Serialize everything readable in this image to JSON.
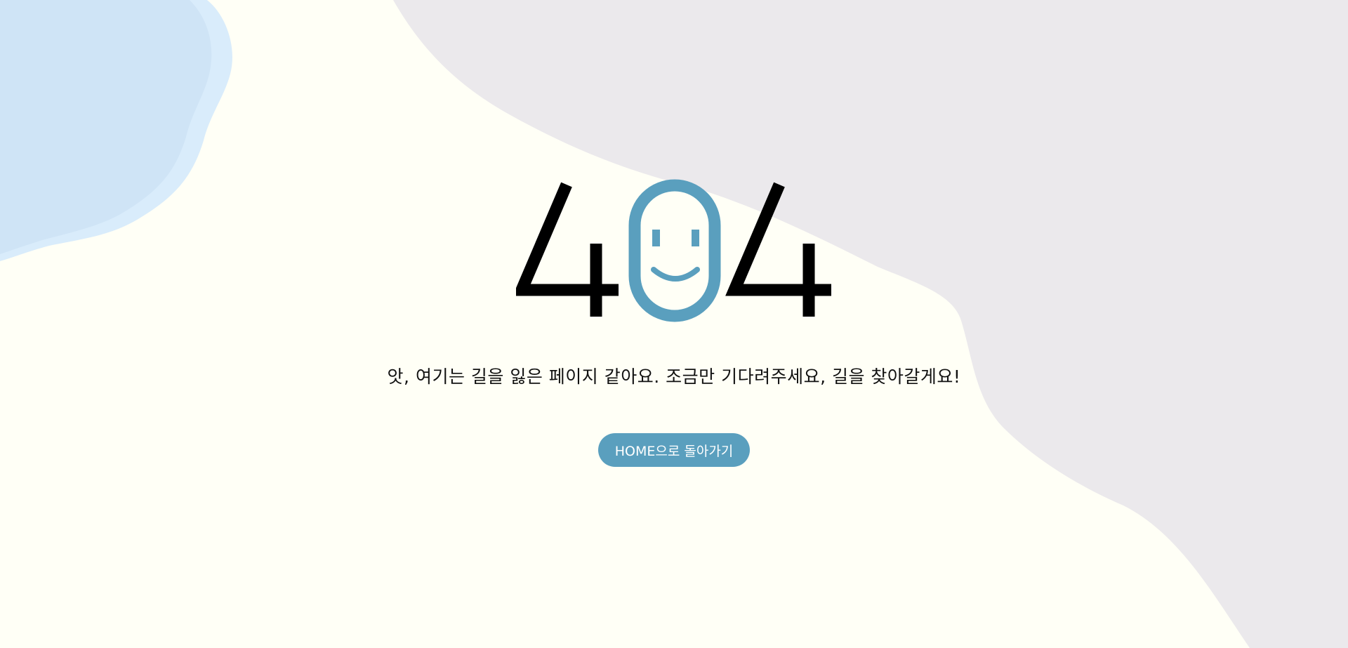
{
  "error": {
    "digit_left": "4",
    "digit_right": "4",
    "face_icon": "smiley-face-zero-icon"
  },
  "message": "앗, 여기는 길을 잃은 페이지 같아요. 조금만 기다려주세요, 길을 찾아갈게요!",
  "home_button": {
    "label": "HOME으로 돌아가기"
  },
  "colors": {
    "background": "#fffff6",
    "accent": "#5a9fbe",
    "blue_blob": "#cfe4f6",
    "gray_blob": "#ebe9ec",
    "text": "#111111"
  }
}
